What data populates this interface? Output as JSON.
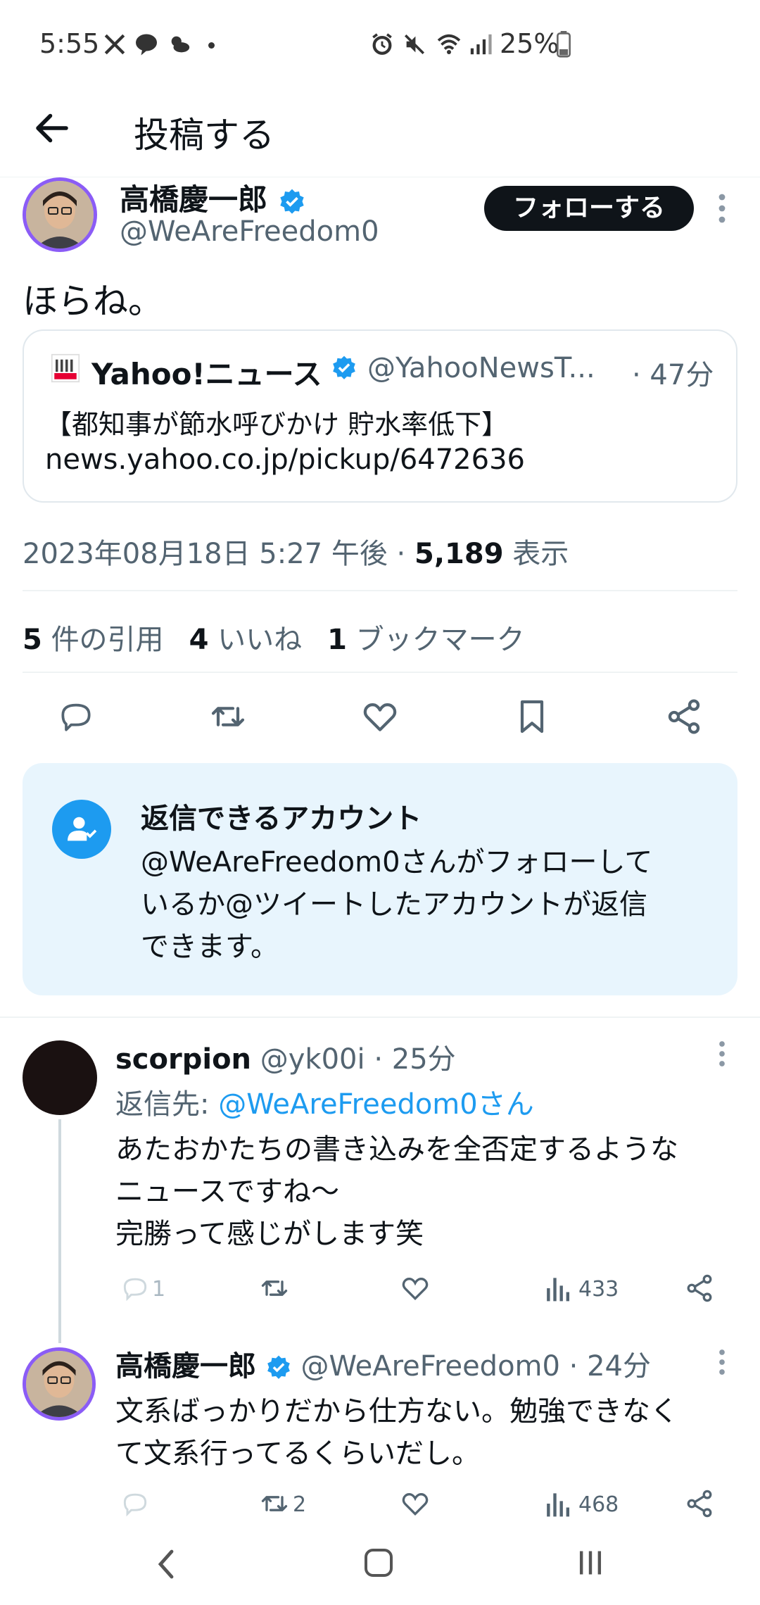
{
  "status_bar": {
    "time": "5:55",
    "battery": "25%"
  },
  "header": {
    "title": "投稿する"
  },
  "tweet": {
    "author_name": "高橋慶一郎",
    "author_handle": "@WeAreFreedom0",
    "follow_label": "フォローする",
    "text": "ほらね。",
    "quote": {
      "source_name": "Yahoo!ニュース",
      "source_handle": "@YahooNewsT...",
      "time": "· 47分",
      "line1": "【都知事が節水呼びかけ 貯水率低下】",
      "line2": "news.yahoo.co.jp/pickup/6472636"
    },
    "timestamp": "2023年08月18日 5:27 午後 ·",
    "views_count": "5,189",
    "views_label": "表示",
    "stats": {
      "quotes_count": "5",
      "quotes_label": "件の引用",
      "likes_count": "4",
      "likes_label": "いいね",
      "bookmarks_count": "1",
      "bookmarks_label": "ブックマーク"
    }
  },
  "reply_restriction": {
    "title": "返信できるアカウント",
    "line1": "@WeAreFreedom0さんがフォローして",
    "line2": "いるか@ツイートしたアカウントが返信",
    "line3": "できます。"
  },
  "replies": [
    {
      "name": "scorpion",
      "handle": "@yk00i",
      "time": "· 25分",
      "reply_to_prefix": "返信先:",
      "reply_to_handle": "@WeAreFreedom0さん",
      "line1": "あたおかたちの書き込みを全否定するような",
      "line2": "ニュースですね〜",
      "line3": "完勝って感じがします笑",
      "reply_count": "1",
      "retweet_count": "",
      "views": "433"
    },
    {
      "name": "高橋慶一郎",
      "handle": "@WeAreFreedom0",
      "time": "· 24分",
      "line1": "文系ばっかりだから仕方ない。勉強できなく",
      "line2": "て文系行ってるくらいだし。",
      "reply_count": "",
      "retweet_count": "2",
      "views": "468"
    }
  ],
  "colors": {
    "accent": "#1d9bf0",
    "text": "#0f1419",
    "muted": "#536471",
    "reply_box_bg": "#e8f5fd",
    "avatar_ring": "#8b5cf6"
  },
  "icons": {
    "back": "arrow-left-icon",
    "verified": "verified-badge-icon",
    "more": "more-vertical-icon",
    "reply": "reply-icon",
    "retweet": "retweet-icon",
    "like": "heart-icon",
    "bookmark": "bookmark-icon",
    "share": "share-icon",
    "views": "views-icon",
    "account": "account-check-icon"
  }
}
